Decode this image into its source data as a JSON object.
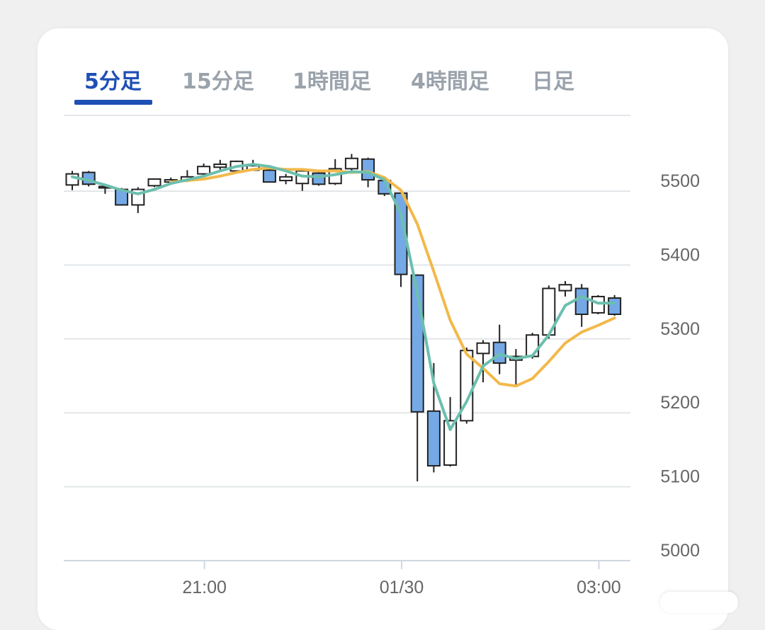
{
  "tabs": [
    {
      "label": "5分足",
      "active": true
    },
    {
      "label": "15分足",
      "active": false
    },
    {
      "label": "1時間足",
      "active": false
    },
    {
      "label": "4時間足",
      "active": false
    },
    {
      "label": "日足",
      "active": false
    }
  ],
  "colors": {
    "accent": "#1f4fb5",
    "bearish_fill": "#74a9e6",
    "bullish_fill": "#ffffff",
    "ma_short": "#6cbfae",
    "ma_long": "#f2b94a",
    "grid": "#e3e6ea",
    "axis_text": "#666666"
  },
  "chart_data": {
    "type": "candlestick",
    "ylim": [
      5000,
      5500
    ],
    "y_ticks": [
      "5500",
      "5400",
      "5300",
      "5200",
      "5100",
      "5000"
    ],
    "x_ticks": [
      {
        "label": "21:00",
        "index": 8
      },
      {
        "label": "01/30",
        "index": 20
      },
      {
        "label": "03:00",
        "index": 32
      }
    ],
    "candles": [
      {
        "o": 5493,
        "h": 5512,
        "l": 5486,
        "c": 5508
      },
      {
        "o": 5510,
        "h": 5512,
        "l": 5491,
        "c": 5494
      },
      {
        "o": 5491,
        "h": 5494,
        "l": 5481,
        "c": 5489
      },
      {
        "o": 5487,
        "h": 5489,
        "l": 5465,
        "c": 5466
      },
      {
        "o": 5466,
        "h": 5490,
        "l": 5455,
        "c": 5487
      },
      {
        "o": 5492,
        "h": 5502,
        "l": 5490,
        "c": 5501
      },
      {
        "o": 5497,
        "h": 5503,
        "l": 5495,
        "c": 5500
      },
      {
        "o": 5499,
        "h": 5513,
        "l": 5497,
        "c": 5504
      },
      {
        "o": 5508,
        "h": 5522,
        "l": 5505,
        "c": 5518
      },
      {
        "o": 5517,
        "h": 5527,
        "l": 5512,
        "c": 5521
      },
      {
        "o": 5512,
        "h": 5526,
        "l": 5511,
        "c": 5525
      },
      {
        "o": 5513,
        "h": 5527,
        "l": 5512,
        "c": 5519
      },
      {
        "o": 5513,
        "h": 5517,
        "l": 5497,
        "c": 5497
      },
      {
        "o": 5499,
        "h": 5508,
        "l": 5494,
        "c": 5504
      },
      {
        "o": 5495,
        "h": 5513,
        "l": 5485,
        "c": 5512
      },
      {
        "o": 5509,
        "h": 5513,
        "l": 5492,
        "c": 5494
      },
      {
        "o": 5495,
        "h": 5528,
        "l": 5493,
        "c": 5515
      },
      {
        "o": 5515,
        "h": 5535,
        "l": 5509,
        "c": 5529
      },
      {
        "o": 5528,
        "h": 5530,
        "l": 5490,
        "c": 5500
      },
      {
        "o": 5499,
        "h": 5501,
        "l": 5478,
        "c": 5481
      },
      {
        "o": 5482,
        "h": 5483,
        "l": 5355,
        "c": 5372
      },
      {
        "o": 5371,
        "h": 5372,
        "l": 5092,
        "c": 5186
      },
      {
        "o": 5187,
        "h": 5252,
        "l": 5104,
        "c": 5113
      },
      {
        "o": 5114,
        "h": 5206,
        "l": 5112,
        "c": 5174
      },
      {
        "o": 5174,
        "h": 5273,
        "l": 5170,
        "c": 5269
      },
      {
        "o": 5265,
        "h": 5283,
        "l": 5226,
        "c": 5279
      },
      {
        "o": 5280,
        "h": 5304,
        "l": 5237,
        "c": 5252
      },
      {
        "o": 5256,
        "h": 5271,
        "l": 5222,
        "c": 5261
      },
      {
        "o": 5261,
        "h": 5293,
        "l": 5258,
        "c": 5290
      },
      {
        "o": 5290,
        "h": 5357,
        "l": 5285,
        "c": 5353
      },
      {
        "o": 5350,
        "h": 5363,
        "l": 5342,
        "c": 5358
      },
      {
        "o": 5353,
        "h": 5359,
        "l": 5301,
        "c": 5318
      },
      {
        "o": 5320,
        "h": 5344,
        "l": 5318,
        "c": 5342
      },
      {
        "o": 5340,
        "h": 5344,
        "l": 5316,
        "c": 5318
      }
    ],
    "ma_short": [
      5504,
      5499,
      5493,
      5486,
      5481,
      5487,
      5495,
      5500,
      5505,
      5512,
      5518,
      5521,
      5518,
      5512,
      5505,
      5504,
      5507,
      5511,
      5510,
      5500,
      5454,
      5347,
      5225,
      5162,
      5200,
      5248,
      5264,
      5258,
      5262,
      5290,
      5330,
      5342,
      5333,
      5333
    ],
    "ma_long": [
      null,
      null,
      null,
      null,
      null,
      null,
      5497,
      5499,
      5501,
      5505,
      5510,
      5514,
      5516,
      5514,
      5514,
      5512,
      5512,
      5510,
      5511,
      5503,
      5486,
      5440,
      5376,
      5310,
      5264,
      5245,
      5224,
      5221,
      5231,
      5254,
      5279,
      5294,
      5303,
      5313
    ]
  }
}
